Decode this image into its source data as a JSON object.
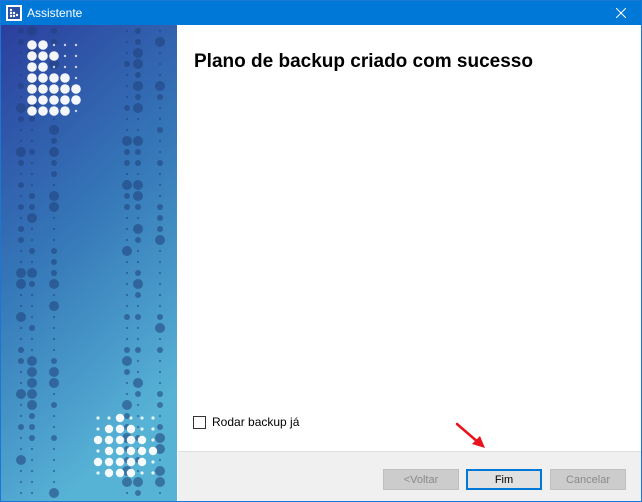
{
  "window": {
    "title": "Assistente",
    "app_icon": "acronis-logo-icon",
    "close_icon": "close-icon"
  },
  "banner": {
    "colors": {
      "top": "#2b3f9e",
      "middle": "#3577b8",
      "bottom": "#57b3d6"
    }
  },
  "content": {
    "heading": "Plano de backup criado com sucesso",
    "run_backup_checkbox": {
      "label": "Rodar backup já",
      "checked": false
    }
  },
  "footer": {
    "back_button": "<Voltar",
    "finish_button": "Fim",
    "cancel_button": "Cancelar"
  },
  "annotation": {
    "icon": "red-arrow-icon",
    "color": "#e8141c"
  }
}
